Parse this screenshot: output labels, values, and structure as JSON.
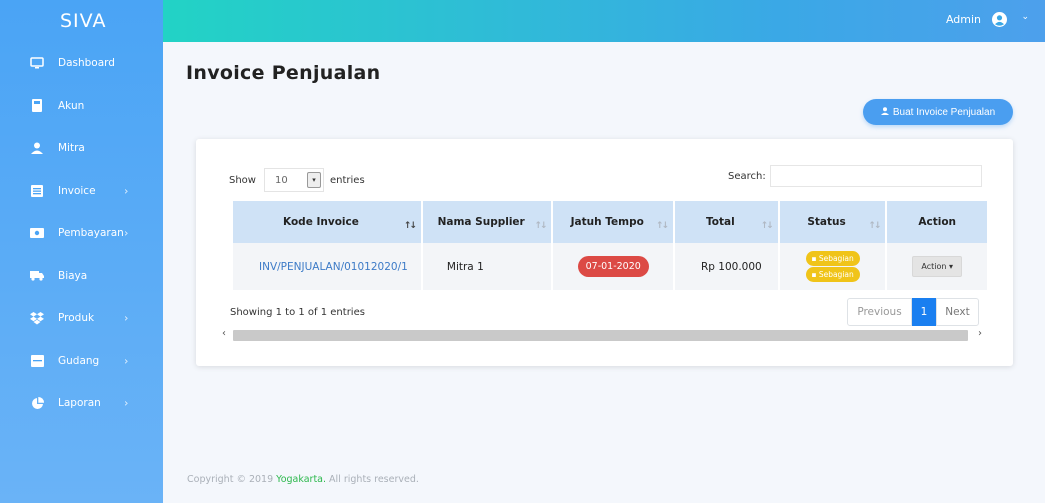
{
  "app": {
    "brand": "SIVA"
  },
  "sidebar": {
    "items": [
      {
        "label": "Dashboard",
        "icon": "monitor-icon",
        "has_chevron": false
      },
      {
        "label": "Akun",
        "icon": "calculator-icon",
        "has_chevron": false
      },
      {
        "label": "Mitra",
        "icon": "user-icon",
        "has_chevron": false
      },
      {
        "label": "Invoice",
        "icon": "list-icon",
        "has_chevron": true
      },
      {
        "label": "Pembayaran",
        "icon": "money-icon",
        "has_chevron": true
      },
      {
        "label": "Biaya",
        "icon": "truck-icon",
        "has_chevron": false
      },
      {
        "label": "Produk",
        "icon": "dropbox-icon",
        "has_chevron": true
      },
      {
        "label": "Gudang",
        "icon": "warehouse-icon",
        "has_chevron": true
      },
      {
        "label": "Laporan",
        "icon": "pie-chart-icon",
        "has_chevron": true
      }
    ],
    "chevron": "›"
  },
  "topbar": {
    "user": "Admin",
    "caret": "⌄"
  },
  "page": {
    "title": "Invoice Penjualan",
    "create_button": "Buat Invoice Penjualan"
  },
  "table_controls": {
    "show_label": "Show",
    "entries_value": "10",
    "entries_label": "entries",
    "search_label": "Search:"
  },
  "table": {
    "columns": [
      "Kode Invoice",
      "Nama Supplier",
      "Jatuh Tempo",
      "Total",
      "Status",
      "Action"
    ],
    "rows": [
      {
        "kode": "INV/PENJUALAN/01012020/1",
        "supplier": "Mitra 1",
        "jatuh_tempo": "07-01-2020",
        "total": "Rp 100.000",
        "status": [
          "Sebagian",
          "Sebagian"
        ],
        "action": "Action"
      }
    ]
  },
  "pagination": {
    "info": "Showing 1 to 1 of 1 entries",
    "previous": "Previous",
    "current": "1",
    "next": "Next"
  },
  "footer": {
    "prefix": "Copyright © 2019",
    "brand": "Yogakarta.",
    "suffix": "All rights reserved."
  },
  "colors": {
    "sidebar": "#4aa4f5",
    "topbar_start": "#22d3c5",
    "topbar_end": "#4da0ec",
    "primary": "#1a7ff0",
    "danger": "#dc4a45",
    "warning": "#f0c419",
    "link": "#3d7bc7",
    "footer_brand": "#2db84d"
  }
}
